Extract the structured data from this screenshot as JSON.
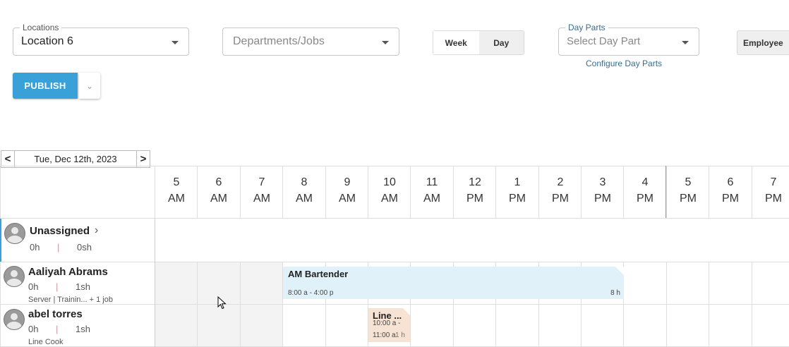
{
  "filters": {
    "location": {
      "legend": "Locations",
      "value": "Location 6"
    },
    "departments": {
      "placeholder": "Departments/Jobs"
    },
    "view_toggle": {
      "week": "Week",
      "day": "Day"
    },
    "day_parts": {
      "legend": "Day Parts",
      "placeholder": "Select Day Part",
      "configure_link": "Configure Day Parts"
    },
    "employee_button": "Employee"
  },
  "actions": {
    "publish": "PUBLISH"
  },
  "date_nav": {
    "date": "Tue, Dec 12th, 2023",
    "prev": "<",
    "next": ">"
  },
  "hours": [
    {
      "h": "5",
      "p": "AM"
    },
    {
      "h": "6",
      "p": "AM"
    },
    {
      "h": "7",
      "p": "AM"
    },
    {
      "h": "8",
      "p": "AM"
    },
    {
      "h": "9",
      "p": "AM"
    },
    {
      "h": "10",
      "p": "AM"
    },
    {
      "h": "11",
      "p": "AM"
    },
    {
      "h": "12",
      "p": "PM"
    },
    {
      "h": "1",
      "p": "PM"
    },
    {
      "h": "2",
      "p": "PM"
    },
    {
      "h": "3",
      "p": "PM"
    },
    {
      "h": "4",
      "p": "PM"
    },
    {
      "h": "5",
      "p": "PM"
    },
    {
      "h": "6",
      "p": "PM"
    },
    {
      "h": "7",
      "p": "PM"
    }
  ],
  "employees": {
    "unassigned": {
      "name": "Unassigned",
      "hours": "0h",
      "sep": "|",
      "shifts": "0sh"
    },
    "aaliyah": {
      "name": "Aaliyah Abrams",
      "hours": "0h",
      "sep": "|",
      "shifts": "1sh",
      "jobs": "Server | Trainin... + 1 job"
    },
    "abel": {
      "name": "abel torres",
      "hours": "0h",
      "sep": "|",
      "shifts": "1sh",
      "jobs": "Line Cook"
    }
  },
  "shifts": {
    "bartender": {
      "title": "AM Bartender",
      "time": "8:00 a - 4:00 p",
      "duration": "8 h",
      "color": "#e1f1fa"
    },
    "linecook": {
      "title": "Line ...",
      "time_start": "10:00 a -",
      "time_end": "11:00 a",
      "duration": "1 h",
      "color": "#f7e3d3"
    }
  }
}
